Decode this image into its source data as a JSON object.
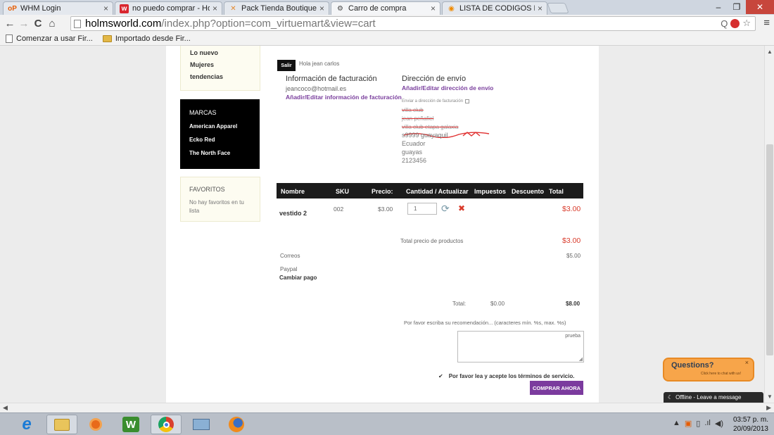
{
  "browser": {
    "tabs": [
      {
        "icon": "oP",
        "label": "WHM Login",
        "close": "×"
      },
      {
        "icon": "w",
        "label": "no puedo comprar - Host",
        "close": "×"
      },
      {
        "icon": "✕",
        "label": "Pack Tienda Boutique - A",
        "close": "×"
      },
      {
        "icon": "⚙",
        "label": "Carro de compra",
        "close": "×"
      },
      {
        "icon": "◉",
        "label": "LISTA DE CODIGOS POSTA",
        "close": "×"
      }
    ],
    "window_controls": {
      "minimize": "–",
      "restore": "❐",
      "close": "✕"
    },
    "url_host": "holmsworld.com",
    "url_path": "/index.php?option=com_virtuemart&view=cart",
    "bookmarks": [
      "Comenzar a usar Fir...",
      "Importado desde Fir..."
    ],
    "nav": {
      "back": "←",
      "forward": "→",
      "reload": "C",
      "home": "⌂"
    },
    "omni_icons": {
      "search": "Q",
      "star": "☆",
      "menu": "≡"
    }
  },
  "sidebar": {
    "menu": [
      "Lo nuevo",
      "Mujeres",
      "tendencias"
    ],
    "brands_title": "MARCAS",
    "brands": [
      "American Apparel",
      "Ecko Red",
      "The North Face"
    ],
    "favorites_title": "FAVORITOS",
    "favorites_empty": "No hay favoritos en tu lista"
  },
  "cart": {
    "logout_button": "Salir",
    "greeting": "Hola jean carlos",
    "billing_title": "Información de facturación",
    "billing_email": "jeancoco@hotmail.es",
    "billing_link": "Añadir/Editar información de facturación",
    "shipping_title": "Dirección de envío",
    "shipping_link": "Añadir/Editar dirección de envío",
    "ship_to_billing": "Enviar a dirección de facturación",
    "shipping_struck": [
      "villa club",
      "jean peñafiel",
      "villa club etapa galaxia"
    ],
    "shipping_lines": [
      "s9999 guayaquil",
      "Ecuador",
      "guayas",
      "2123456"
    ],
    "columns": [
      "Nombre",
      "SKU",
      "Precio:",
      "Cantidad / Actualizar",
      "Impuestos",
      "Descuento",
      "Total"
    ],
    "item": {
      "name": "vestido 2",
      "sku": "002",
      "price": "$3.00",
      "qty": "1",
      "total": "$3.00"
    },
    "products_total_label": "Total precio de productos",
    "products_total": "$3.00",
    "shipment_name": "Correos",
    "shipment_price": "$5.00",
    "payment_name": "Paypal",
    "change_payment": "Cambiar pago",
    "total_label": "Total:",
    "total_tax": "$0.00",
    "grand_total": "$8.00",
    "comment_label": "Por favor escriba su recomendación... (caracteres mín. %s, max. %s)",
    "comment_value": "prueba",
    "tos_label": "Por favor lea y acepte los términos de servicio.",
    "checkout_button": "COMPRAR AHORA"
  },
  "chat": {
    "title": "Questions?",
    "subtitle": "Click here to chat with us!",
    "close": "×",
    "status": "Offline - Leave a message"
  },
  "taskbar": {
    "time": "03:57 p. m.",
    "date": "20/09/2013"
  },
  "colors": {
    "accent_purple": "#7a3f9d",
    "price_red": "#d93b2b",
    "checkout_bg": "#7b3b9e",
    "chat_orange": "#f7a54a"
  }
}
